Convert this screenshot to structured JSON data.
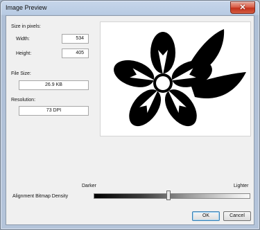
{
  "window": {
    "title": "Image Preview",
    "close_glyph": "✕"
  },
  "size": {
    "heading": "Size in pixels:",
    "width_label": "Width:",
    "width_value": "534",
    "height_label": "Height:",
    "height_value": "405"
  },
  "file_size": {
    "label": "File Size:",
    "value": "26.9 KB"
  },
  "resolution": {
    "label": "Resolution:",
    "value": "73 DPI"
  },
  "density": {
    "label": "Alignment Bitmap Density",
    "darker_label": "Darker",
    "lighter_label": "Lighter",
    "level": 0.47
  },
  "buttons": {
    "ok": "OK",
    "cancel": "Cancel"
  },
  "preview": {
    "icon": "flower-icon"
  },
  "colors": {
    "close": "#c4321d",
    "title_bar": "#b8cbe3",
    "client": "#f0f0f0"
  }
}
